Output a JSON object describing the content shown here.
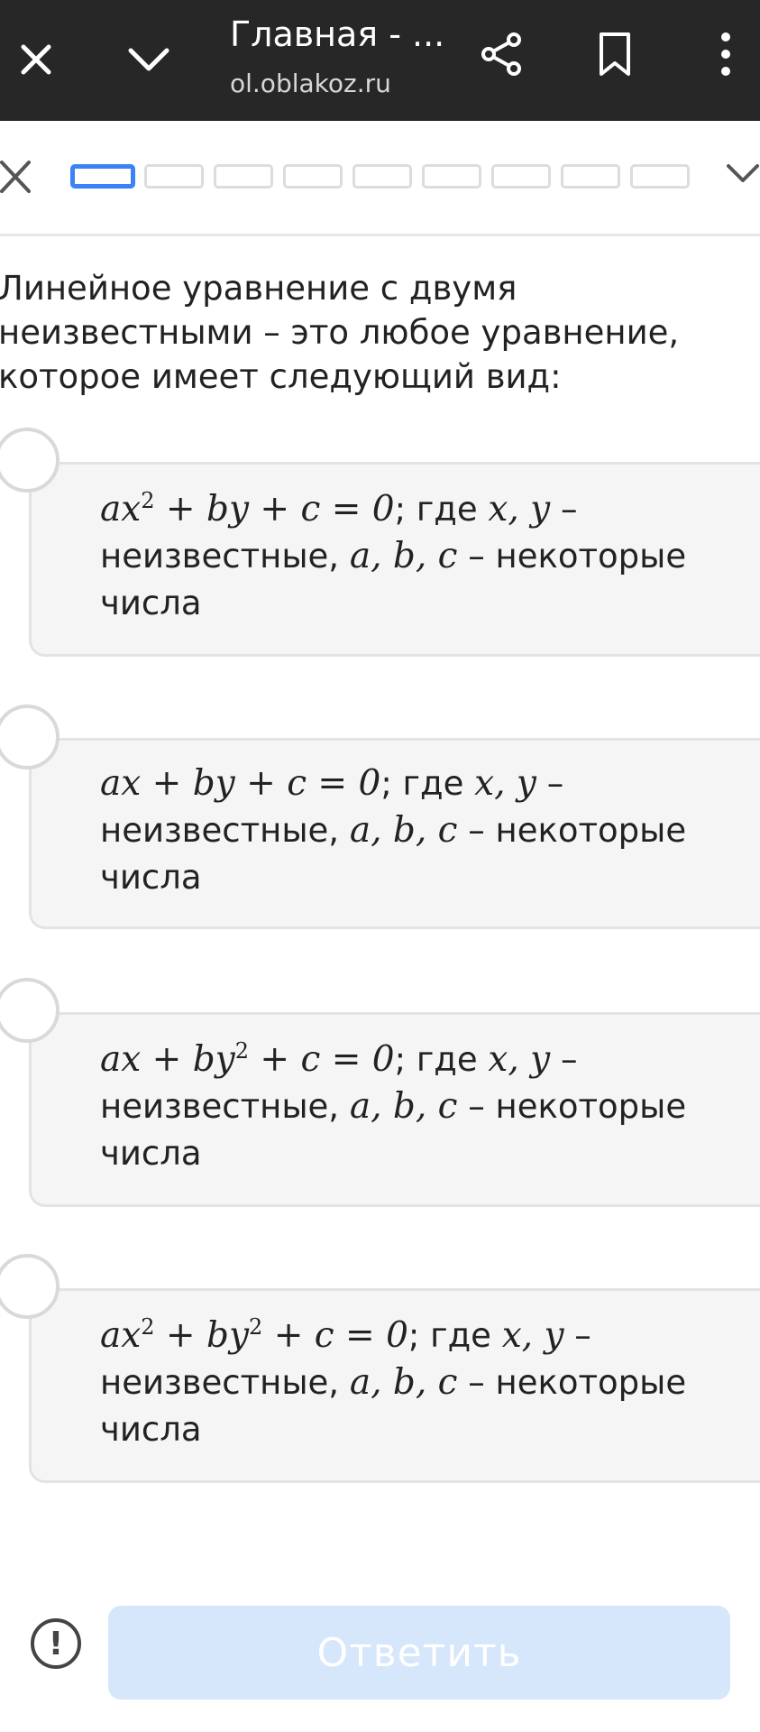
{
  "browser": {
    "title": "Главная - ...",
    "url": "ol.oblakoz.ru",
    "icons": [
      "close-icon",
      "chevron-down-icon",
      "share-icon",
      "bookmark-icon",
      "more-vert-icon"
    ]
  },
  "progress": {
    "total_steps": 9,
    "current_step": 1,
    "icons": [
      "close-icon",
      "chevron-down-icon"
    ]
  },
  "question": {
    "text": "Линейное уравнение с двумя неизвестными – это любое уравнение, которое имеет следующий вид:"
  },
  "options": [
    {
      "math_before": "ax",
      "math_sup": "2",
      "math_after": " + by + c = 0",
      "text_a": "; где ",
      "vars_xy": "x, y",
      "text_b": " – неизвестные, ",
      "vars_abc": "a, b, c",
      "text_c": " – некоторые числа"
    },
    {
      "math_before": "ax + by + c = 0",
      "text_a": "; где ",
      "vars_xy": "x, y",
      "text_b": " – неизвестные, ",
      "vars_abc": "a, b, c",
      "text_c": " – некоторые числа"
    },
    {
      "math_before": "ax + by",
      "math_sup": "2",
      "math_after": " + c = 0",
      "text_a": "; где ",
      "vars_xy": "x, y",
      "text_b": " – неизвестные, ",
      "vars_abc": "a, b, c",
      "text_c": " – некоторые числа"
    },
    {
      "math_before": "ax",
      "math_sup": "2",
      "math_mid": " + by",
      "math_sup2": "2",
      "math_after": " + c = 0",
      "text_a": "; где ",
      "vars_xy": "x, y",
      "text_b": " – неизвестные, ",
      "vars_abc": "a, b, c",
      "text_c": " – некоторые числа"
    }
  ],
  "footer": {
    "submit_label": "Ответить",
    "info_icon": "!"
  },
  "colors": {
    "topbar_bg": "#272727",
    "accent": "#3b82f6",
    "submit_disabled": "#d6e6fb",
    "card_bg": "#f5f5f5"
  }
}
